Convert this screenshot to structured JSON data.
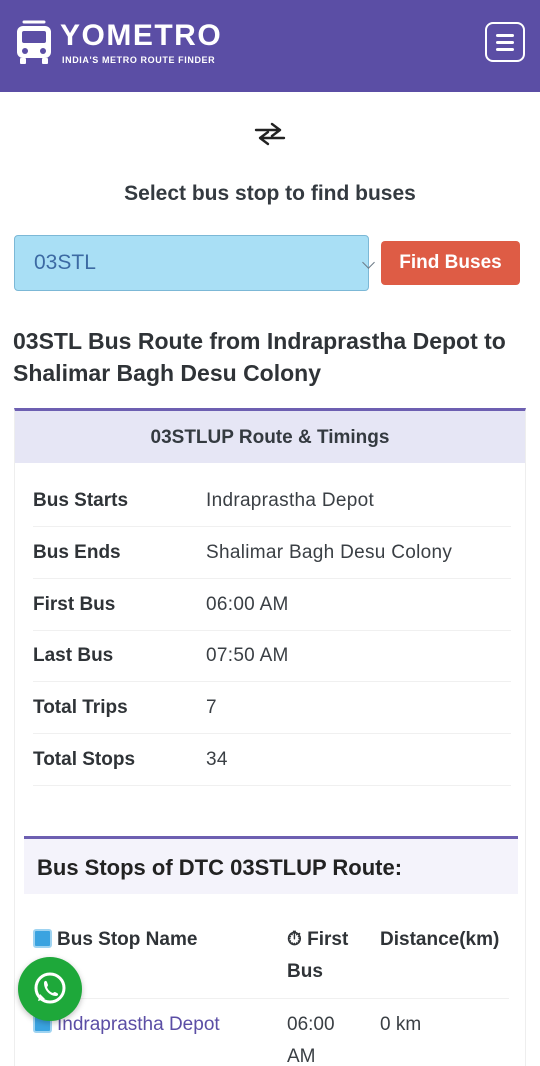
{
  "header": {
    "brand": "YOMETRO",
    "tagline": "INDIA'S METRO ROUTE FINDER",
    "logo_icon": "bus-icon",
    "menu_icon": "hamburger-icon",
    "bg_color": "#5b4ea5"
  },
  "search": {
    "swap_icon": "swap-arrows-icon",
    "title": "Select bus stop to find buses",
    "selected_value": "03STL",
    "button_label": "Find Buses",
    "button_color": "#de5c45"
  },
  "route": {
    "heading": "03STL Bus Route from Indraprastha Depot to Shalimar Bagh Desu Colony",
    "card_title": "03STLUP Route & Timings",
    "rows": [
      {
        "label": "Bus Starts",
        "value": "Indraprastha Depot"
      },
      {
        "label": "Bus Ends",
        "value": "Shalimar Bagh Desu Colony"
      },
      {
        "label": "First Bus",
        "value": "06:00 AM"
      },
      {
        "label": "Last Bus",
        "value": "07:50 AM"
      },
      {
        "label": "Total Trips",
        "value": "7"
      },
      {
        "label": "Total Stops",
        "value": "34"
      }
    ]
  },
  "stops": {
    "title": "Bus Stops of DTC 03STLUP Route:",
    "columns": {
      "name": "Bus Stop Name",
      "first_bus": "⏱ First Bus",
      "distance": "Distance(km)"
    },
    "rows": [
      {
        "name": "Indraprastha Depot",
        "first_bus": "06:00 AM",
        "distance": "0 km"
      }
    ]
  },
  "floating": {
    "whatsapp_icon": "whatsapp-icon",
    "color": "#1ea83a"
  }
}
